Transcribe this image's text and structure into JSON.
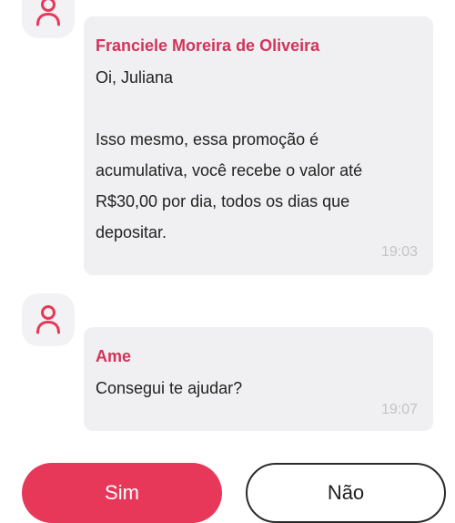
{
  "messages": [
    {
      "sender": "Franciele Moreira de Oliveira",
      "lines": [
        "Oi, Juliana",
        "",
        "Isso mesmo, essa promoção é",
        "acumulativa, você recebe o valor até",
        "R$30,00 por dia, todos os dias que",
        "depositar."
      ],
      "time": "19:03",
      "avatar_icon": "user-icon"
    },
    {
      "sender": "Ame",
      "lines": [
        "Consegui te ajudar?"
      ],
      "time": "19:07",
      "avatar_icon": "user-icon"
    }
  ],
  "actions": {
    "yes_label": "Sim",
    "no_label": "Não"
  },
  "colors": {
    "accent": "#e8385a",
    "sender": "#d2335b",
    "bubble": "#f0f0f2",
    "avatar_bg": "#f2f2f4",
    "timestamp": "#c3c3c7"
  }
}
